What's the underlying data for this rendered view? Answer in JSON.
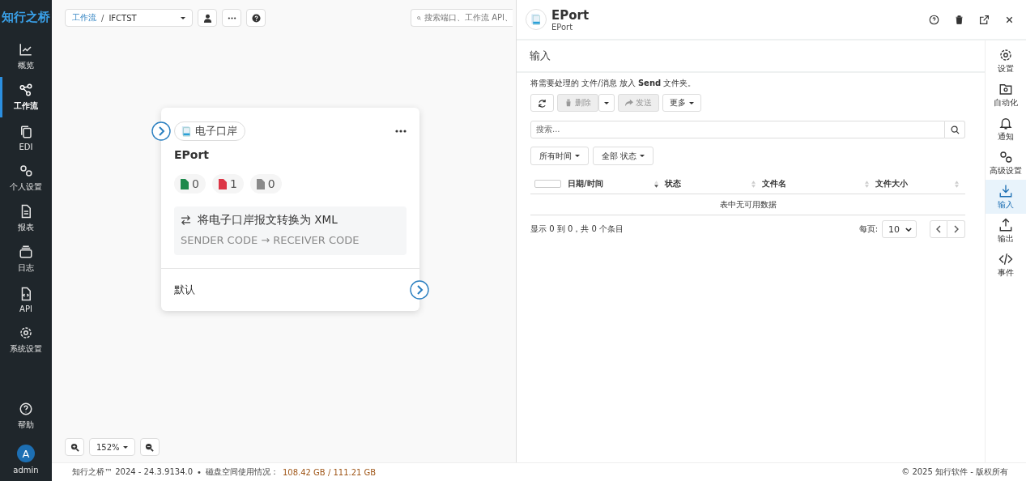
{
  "sidebar": {
    "logo": "知行之桥",
    "items": [
      {
        "label": "概览",
        "selected": false
      },
      {
        "label": "工作流",
        "selected": true
      },
      {
        "label": "EDI",
        "selected": false
      },
      {
        "label": "个人设置",
        "selected": false
      },
      {
        "label": "报表",
        "selected": false
      },
      {
        "label": "日志",
        "selected": false
      },
      {
        "label": "API",
        "selected": false
      },
      {
        "label": "系统设置",
        "selected": false
      }
    ],
    "help": "帮助",
    "user": {
      "initial": "A",
      "name": "admin"
    }
  },
  "canvas": {
    "breadcrumb": {
      "parent": "工作流",
      "separator": "/",
      "current": "IFCTST"
    },
    "search": {
      "placeholder": "搜索端口、工作流 API、"
    },
    "node": {
      "port_type": "电子口岸",
      "name": "EPort",
      "counts": [
        {
          "value": "0",
          "color": "#1e8a4c"
        },
        {
          "value": "1",
          "color": "#dc3545"
        },
        {
          "value": "0",
          "color": "#8a8a8a"
        }
      ],
      "description": "将电子口岸报文转换为 XML",
      "route": "SENDER CODE → RECEIVER CODE",
      "output": "默认"
    },
    "zoom": "152%"
  },
  "panel": {
    "title": "EPort",
    "subtitle": "EPort",
    "section": "输入",
    "hint": "将需要处理的 文件/消息 放入 **Send** 文件夹。",
    "toolbar": [
      {
        "kind": "refresh",
        "disabled": false
      },
      {
        "label": "删除",
        "kind": "split",
        "disabled": true
      },
      {
        "label": "发送",
        "kind": "send",
        "disabled": true
      },
      {
        "label": "更多",
        "kind": "menu",
        "disabled": false
      }
    ],
    "search": {
      "placeholder": "搜索..."
    },
    "filters": [
      "所有时间",
      "全部 状态"
    ],
    "table": {
      "select_all": {
        "checked": false
      },
      "columns": [
        "日期/时间",
        "状态",
        "文件名",
        "文件大小"
      ],
      "empty": "表中无可用数据"
    },
    "info": "显示 0 到 0，共 0 个条目",
    "page_size_label": "每页:",
    "page_size": "10",
    "rail": [
      {
        "label": "设置",
        "selected": false
      },
      {
        "label": "自动化",
        "selected": false
      },
      {
        "label": "通知",
        "selected": false
      },
      {
        "label": "高级设置",
        "selected": false
      },
      {
        "label": "输入",
        "selected": true
      },
      {
        "label": "输出",
        "selected": false
      },
      {
        "label": "事件",
        "selected": false
      }
    ]
  },
  "footer": {
    "version": "知行之桥™ 2024 - 24.3.9134.0",
    "sep": "•",
    "disk_label": "磁盘空间使用情况：",
    "disk": "108.42 GB / 111.21 GB",
    "copyright": "© 2025 知行软件 - 版权所有"
  }
}
